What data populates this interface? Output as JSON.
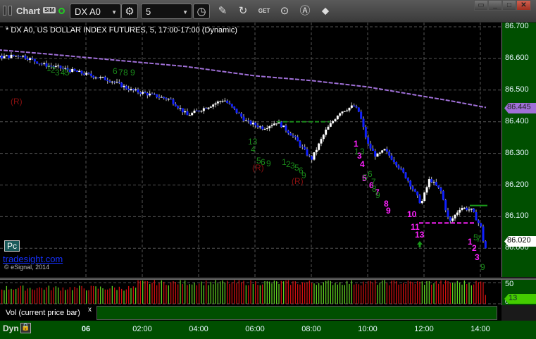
{
  "window": {
    "title": "Chart",
    "sim_badge": "SIM",
    "symbol": "DX A0",
    "interval": "5"
  },
  "toolbar": {
    "icons": [
      "settings-gear-icon",
      "clock-icon",
      "pencil-icon",
      "refresh-icon",
      "get-icon",
      "play-icon",
      "alert-icon",
      "link-icon"
    ],
    "get_label": "GET"
  },
  "chart": {
    "header": "* DX A0, US DOLLAR INDEX FUTURES, 5, 17:00-17:00 (Dynamic)",
    "price_labels": [
      "86.700",
      "86.600",
      "86.500",
      "86.400",
      "86.300",
      "86.200",
      "86.100",
      "86.000"
    ],
    "ma_value": "86.445",
    "last_price": "86.020",
    "pc_button": "Pc",
    "link": "tradesight.com",
    "copyright": "© eSignal, 2014",
    "colors": {
      "up": "#ffffff",
      "down": "#1020ff",
      "ma": "#a070d8",
      "magenta": "#ff22ff",
      "green": "#1a8a1a",
      "axis_bg": "#004f00"
    },
    "annotations": {
      "r_labels": [
        "(R)",
        "(R)",
        "(R)"
      ],
      "magenta": [
        "1",
        "3",
        "4",
        "5",
        "6",
        "7",
        "8",
        "9",
        "10",
        "11",
        "13",
        "1",
        "2",
        "3"
      ],
      "green": [
        "1",
        "2",
        "3",
        "4",
        "5",
        "6",
        "7",
        "8",
        "9",
        "13",
        "4",
        "5",
        "6",
        "9",
        "1",
        "2",
        "3",
        "5",
        "6",
        "9",
        "1",
        "3",
        "5",
        "6",
        "7",
        "8",
        "9",
        "5",
        "7",
        "9"
      ]
    },
    "price_path": [
      [
        -5.9,
        86.66
      ],
      [
        -5.3,
        86.59
      ],
      [
        -4.6,
        86.62
      ],
      [
        -3.6,
        86.6
      ],
      [
        -2.3,
        86.61
      ],
      [
        -1.5,
        86.58
      ],
      [
        -0.9,
        86.57
      ],
      [
        0.9,
        86.53
      ],
      [
        1.6,
        86.5
      ],
      [
        3.0,
        86.47
      ],
      [
        3.6,
        86.42
      ],
      [
        4.9,
        86.47
      ],
      [
        5.7,
        86.4
      ],
      [
        6.3,
        86.38
      ],
      [
        6.8,
        86.4
      ],
      [
        7.4,
        86.35
      ],
      [
        8.0,
        86.28
      ],
      [
        8.5,
        86.37
      ],
      [
        9.0,
        86.43
      ],
      [
        9.5,
        86.45
      ],
      [
        9.7,
        86.43
      ],
      [
        10.0,
        86.33
      ],
      [
        10.3,
        86.29
      ],
      [
        10.6,
        86.31
      ],
      [
        11.0,
        86.27
      ],
      [
        11.4,
        86.22
      ],
      [
        11.9,
        86.14
      ],
      [
        12.2,
        86.22
      ],
      [
        12.6,
        86.18
      ],
      [
        12.9,
        86.08
      ],
      [
        13.3,
        86.13
      ],
      [
        13.7,
        86.12
      ],
      [
        14.05,
        86.06
      ],
      [
        14.15,
        85.99
      ],
      [
        14.25,
        86.02
      ]
    ],
    "ma_path": [
      [
        -5.9,
        86.66
      ],
      [
        -3.5,
        86.63
      ],
      [
        -1.5,
        86.615
      ],
      [
        1.0,
        86.595
      ],
      [
        3.5,
        86.575
      ],
      [
        6.0,
        86.545
      ],
      [
        8.0,
        86.53
      ],
      [
        10.0,
        86.51
      ],
      [
        12.0,
        86.48
      ],
      [
        13.0,
        86.465
      ],
      [
        14.2,
        86.445
      ]
    ]
  },
  "volume": {
    "label": "Vol (current price bar)",
    "close": "x",
    "axis_labels": [
      "50",
      "0"
    ],
    "current": "13"
  },
  "time_axis": {
    "mode": "Dyn",
    "labels": [
      "06",
      "02:00",
      "04:00",
      "06:00",
      "08:00",
      "10:00",
      "12:00",
      "14:00"
    ]
  }
}
